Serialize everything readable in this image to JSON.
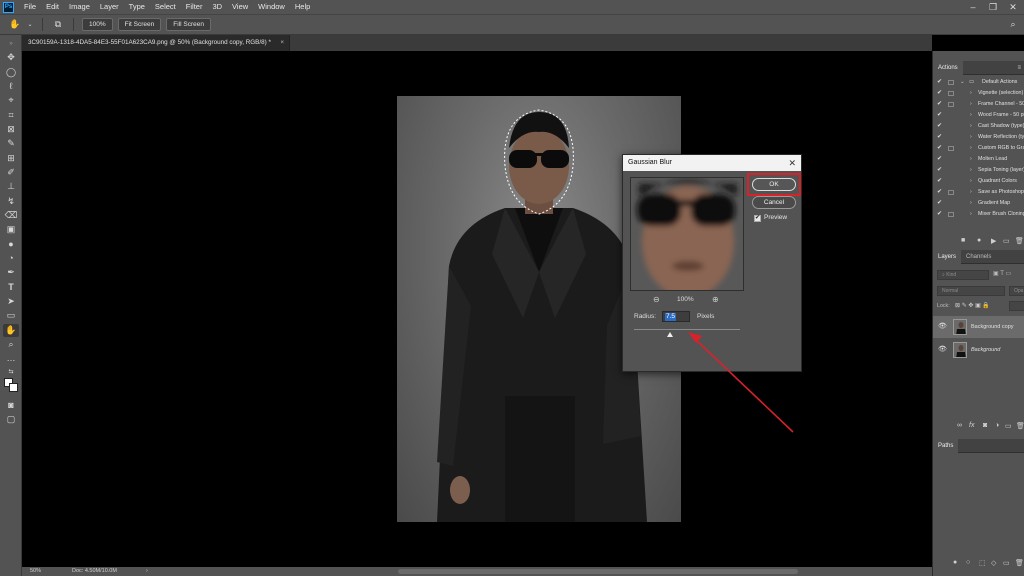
{
  "menu": {
    "logo": "Ps",
    "items": [
      "File",
      "Edit",
      "Image",
      "Layer",
      "Type",
      "Select",
      "Filter",
      "3D",
      "View",
      "Window",
      "Help"
    ]
  },
  "options_bar": {
    "zoom_100": "100%",
    "fit_screen": "Fit Screen",
    "fill_screen": "Fill Screen"
  },
  "document_tab": {
    "title": "3C90159A-1318-4DA5-84E3-55F01A623CA9.png @ 50% (Background copy, RGB/8) *",
    "close": "×"
  },
  "status_bar": {
    "zoom": "50%",
    "doc": "Doc: 4.50M/10.0M",
    "arrow": "›"
  },
  "actions_panel": {
    "tab": "Actions",
    "group": "Default Actions",
    "items": [
      "Vignette (selection)",
      "Frame Channel - 50 pixel",
      "Wood Frame - 50 pixel",
      "Cast Shadow (type)",
      "Water Reflection (type)",
      "Custom RGB to Grayscale",
      "Molten Lead",
      "Sepia Toning (layer)",
      "Quadrant Colors",
      "Save as Photoshop PDF",
      "Gradient Map",
      "Mixer Brush Cloning"
    ]
  },
  "layers_panel": {
    "tabs": [
      "Layers",
      "Channels"
    ],
    "kind_placeholder": "Kind",
    "blend_mode": "Normal",
    "opacity_label": "Opa",
    "lock_label": "Lock:",
    "layers": [
      {
        "name": "Background copy",
        "selected": true
      },
      {
        "name": "Background",
        "selected": false
      }
    ]
  },
  "paths_panel": {
    "tab": "Paths"
  },
  "dialog": {
    "title": "Gaussian Blur",
    "ok": "OK",
    "cancel": "Cancel",
    "preview_label": "Preview",
    "preview_checked": true,
    "zoom": "100%",
    "radius_label": "Radius:",
    "radius_value": "7.5",
    "units": "Pixels",
    "slider_fraction": 0.34
  },
  "colors": {
    "highlight": "#d7222a",
    "selection_blue": "#2d6cc4"
  }
}
